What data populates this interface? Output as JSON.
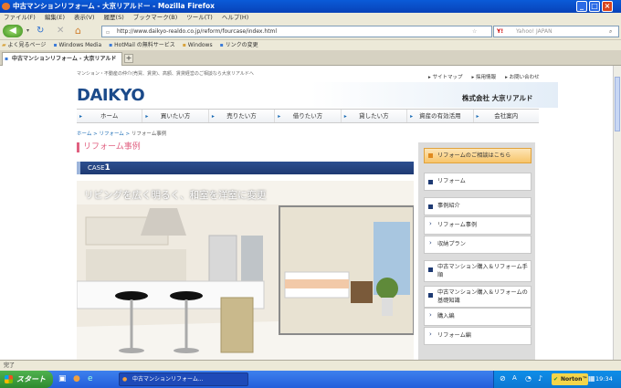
{
  "window": {
    "title": "中古マンションリフォーム - 大京リアルドー - Mozilla Firefox"
  },
  "menu": [
    "ファイル(F)",
    "編集(E)",
    "表示(V)",
    "履歴(S)",
    "ブックマーク(B)",
    "ツール(T)",
    "ヘルプ(H)"
  ],
  "nav": {
    "url": "http://www.daikyo-realdo.co.jp/reform/fourcase/index.html",
    "search_placeholder": "Yahoo! JAPAN"
  },
  "bookmarks": [
    "よく見るページ",
    "Windows Media",
    "HotMail の無料サービス",
    "Windows",
    "リンクの変更"
  ],
  "tab": {
    "label": "中古マンションリフォーム - 大京リアルドー"
  },
  "site": {
    "tagline": "マンション・不動産の仲介(売買、賃貸)、高額、賃貸経営のご相談なら大京リアルドへ",
    "toplinks": [
      "サイトマップ",
      "採用情報",
      "お問い合わせ"
    ],
    "logo": "DAIKYO",
    "company": "株式会社 大京リアルド",
    "gnav": [
      "ホーム",
      "買いたい方",
      "売りたい方",
      "借りたい方",
      "貸したい方",
      "資産の有効活用",
      "会社案内"
    ],
    "breadcrumb": {
      "home": "ホーム",
      "sep": ">",
      "reform": "リフォーム",
      "current": "リフォーム事例"
    },
    "heading": "リフォーム事例",
    "case_label": "CASE",
    "case_number": "1",
    "photo_caption": "リビングを広く明るく、和室を洋室に変更"
  },
  "sidebar": {
    "consult": "リフォームのご相談はこちら",
    "items": [
      "リフォーム",
      "事例紹介",
      "リフォーム事例",
      "収納プラン",
      "中古マンション購入＆リフォーム手順",
      "中古マンション購入＆リフォームの基礎知識",
      "購入編",
      "リフォーム編"
    ]
  },
  "status": "完了",
  "taskbar": {
    "start": "スタート",
    "window": "中古マンションリフォーム...",
    "norton": "Norton™",
    "clock": "19:34"
  }
}
